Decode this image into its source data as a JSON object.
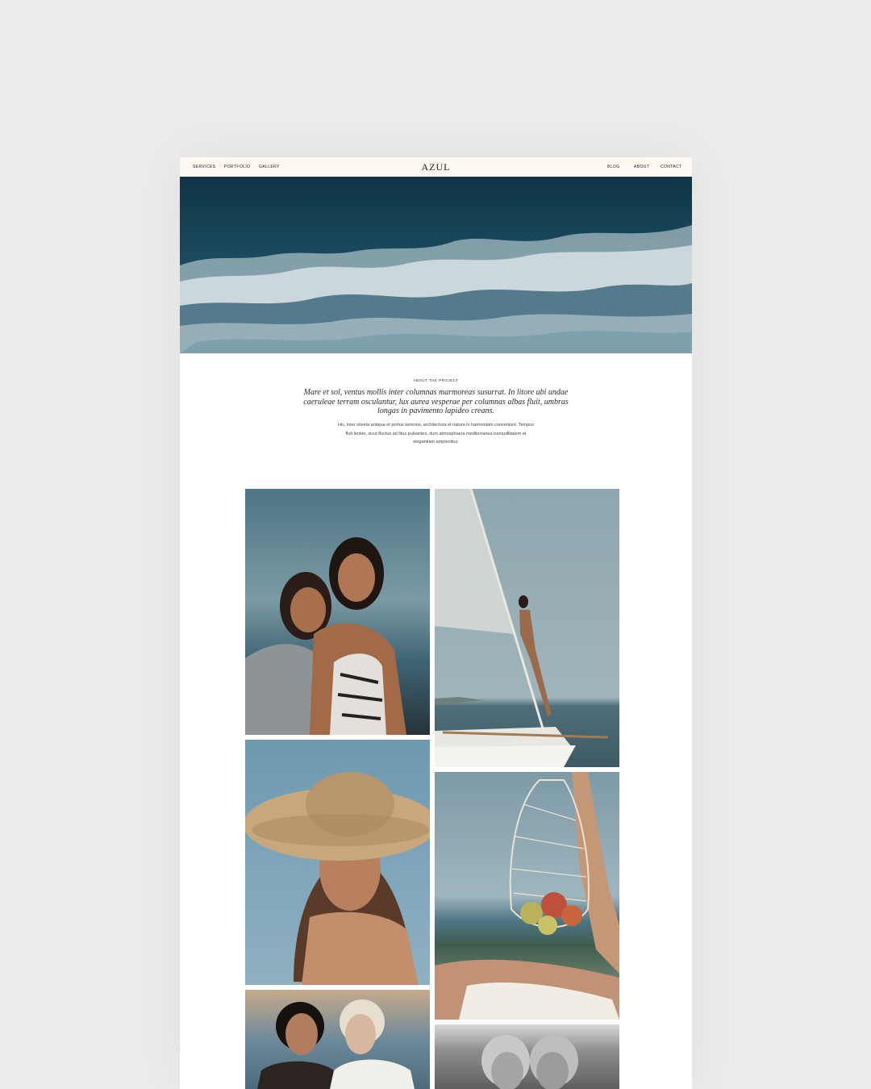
{
  "nav": {
    "left_links": [
      "SERVICES",
      "PORTFOLIO",
      "GALLERY"
    ],
    "logo": "AZUL",
    "right_links": [
      "BLOG",
      "ABOUT",
      "CONTACT"
    ]
  },
  "about": {
    "eyebrow": "ABOUT THE PROJECT",
    "lead": "Mare et sol, ventus mollis inter columnas marmoreas susurrat. In litore ubi undae caeruleae terram osculantur, lux aurea vesperae per columnas albas fluit, umbras longas in pavimento lapideo creans.",
    "body": "Hic, inter oliveta antiqua et portus serenos, architectura et natura in harmoniam conveniunt. Tempus fluit leniter, sicut fluctus ad litus pulsantes, dum atmosphaera mediterranea tranquillitatem et elegantiam amplectitur."
  },
  "colors": {
    "page_background": "#ececec",
    "nav_background": "#fbf9f2",
    "ocean": "#173f52"
  }
}
